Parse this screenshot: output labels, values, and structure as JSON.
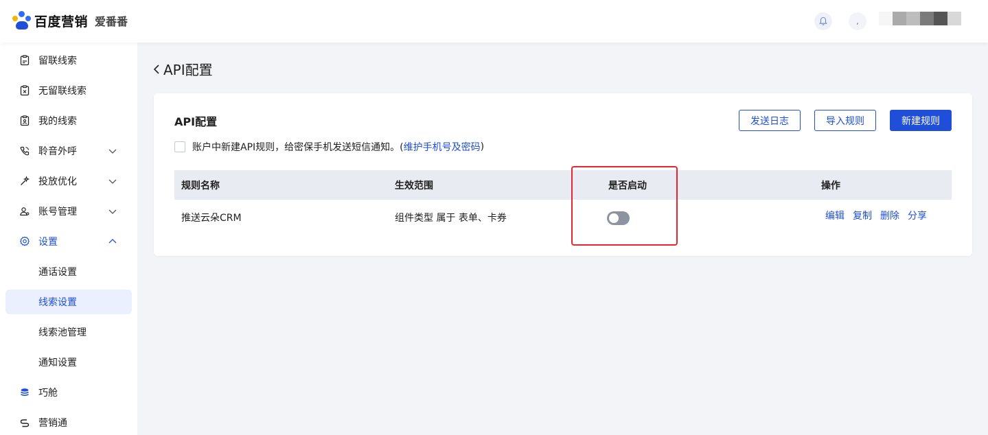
{
  "brand": {
    "name": "百度营销",
    "product": "爱番番"
  },
  "header": {
    "bell_icon": "bell-icon",
    "avatar_text": ","
  },
  "sidebar": {
    "items": [
      {
        "label": "留联线索",
        "icon": "clipboard-edit-icon"
      },
      {
        "label": "无留联线索",
        "icon": "clipboard-x-icon"
      },
      {
        "label": "我的线索",
        "icon": "clipboard-user-icon"
      },
      {
        "label": "聆音外呼",
        "icon": "phone-icon",
        "expandable": true
      },
      {
        "label": "投放优化",
        "icon": "magic-wand-icon",
        "expandable": true
      },
      {
        "label": "账号管理",
        "icon": "user-group-icon",
        "expandable": true
      },
      {
        "label": "设置",
        "icon": "gear-icon",
        "expanded": true
      },
      {
        "label": "巧舱",
        "icon": "database-icon"
      },
      {
        "label": "营销通",
        "icon": "link-icon"
      }
    ],
    "settings_children": [
      {
        "label": "通话设置"
      },
      {
        "label": "线索设置",
        "selected": true
      },
      {
        "label": "线索池管理"
      },
      {
        "label": "通知设置"
      }
    ]
  },
  "page": {
    "title": "API配置"
  },
  "card": {
    "title": "API配置",
    "buttons": {
      "send_log": "发送日志",
      "import_rules": "导入规则",
      "new_rule": "新建规则"
    },
    "notice": {
      "text": "账户中新建API规则，给密保手机发送短信通知。(",
      "link": "维护手机号及密码",
      "suffix": ")",
      "checked": false
    }
  },
  "table": {
    "columns": [
      "规则名称",
      "生效范围",
      "是否启动",
      "操作"
    ],
    "rows": [
      {
        "name": "推送云朵CRM",
        "scope": "组件类型 属于 表单、卡券",
        "enabled": false,
        "actions": [
          "编辑",
          "复制",
          "删除",
          "分享"
        ]
      }
    ]
  },
  "colors": {
    "primary": "#1f4ed8",
    "highlight": "#e8252c",
    "toggle_off": "#8e949f",
    "table_header": "#e9ebf2"
  }
}
